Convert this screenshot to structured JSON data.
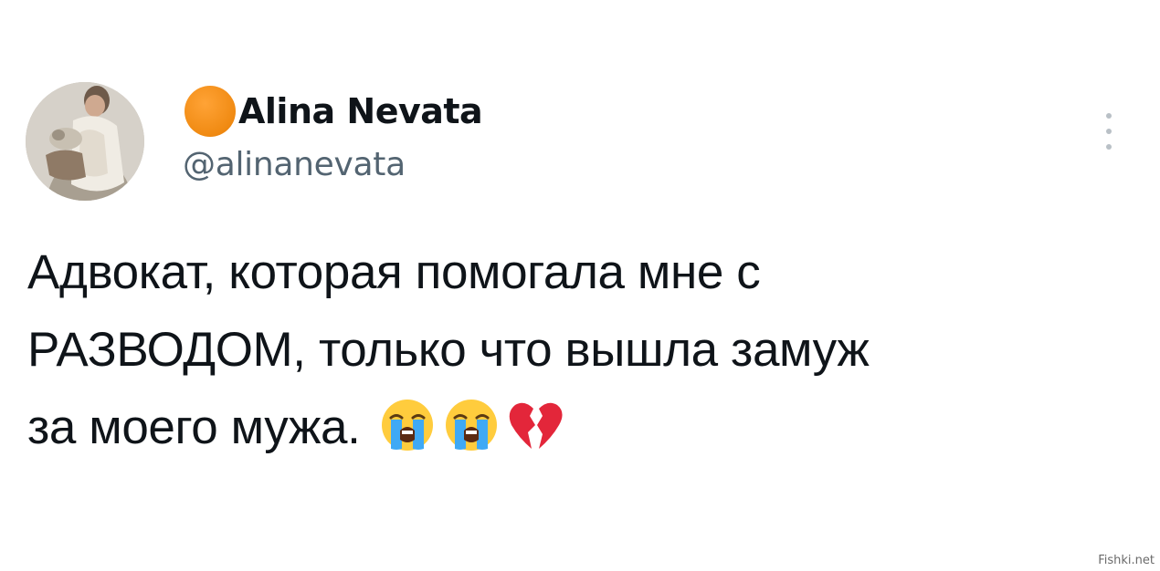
{
  "author": {
    "display_name": "Alina Nevata",
    "handle": "@alinanevata"
  },
  "tweet": {
    "lines": [
      "Адвокат, которая помогала мне с",
      "РАЗВОДОМ, только что вышла замуж",
      "за моего мужа."
    ],
    "emojis": [
      "loudly-crying-face",
      "loudly-crying-face",
      "broken-heart"
    ]
  },
  "watermark": "Fishki.net",
  "colors": {
    "text": "#0f1419",
    "secondary": "#536471",
    "status_dot": "#f08a12",
    "menu_dots": "#b9c0c6"
  }
}
